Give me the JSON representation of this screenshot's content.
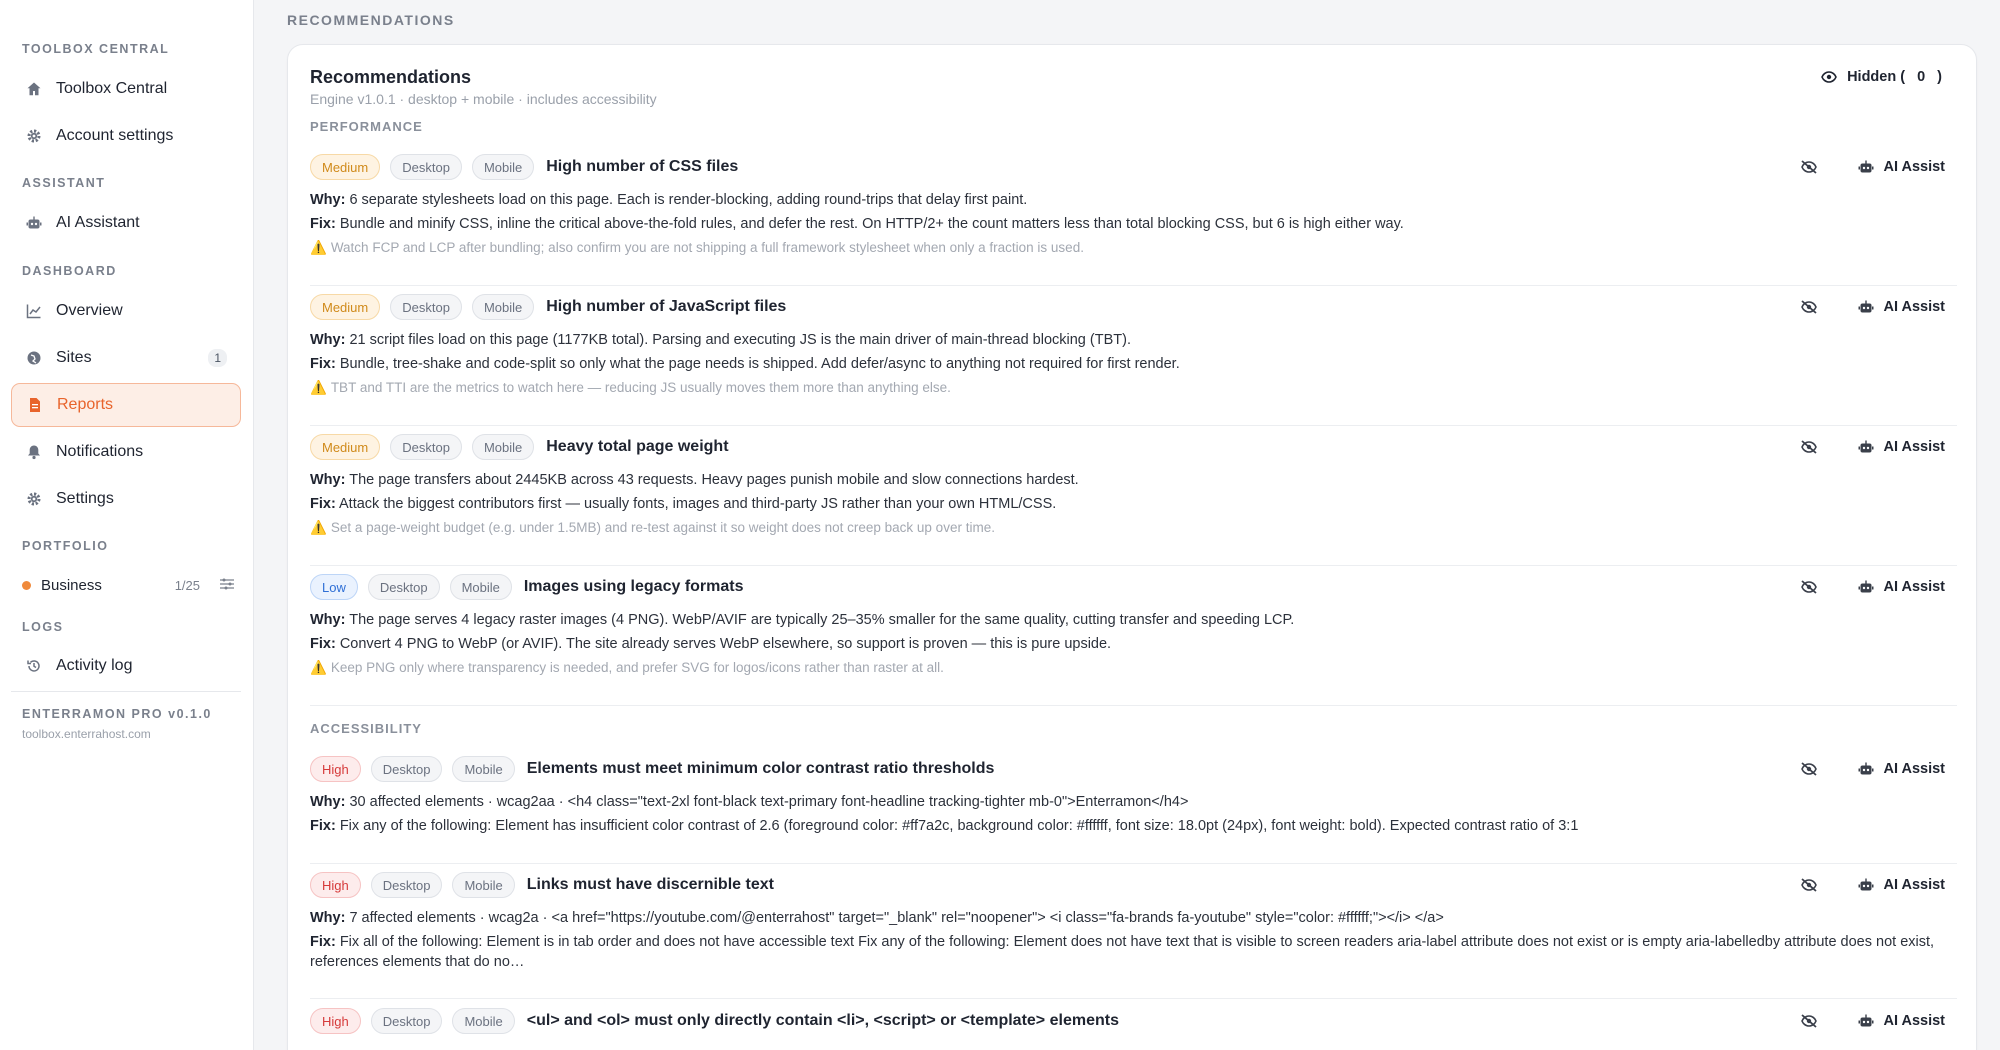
{
  "sidebar": {
    "sections": {
      "toolbox": "TOOLBOX CENTRAL",
      "assistant": "ASSISTANT",
      "dashboard": "DASHBOARD",
      "portfolio": "PORTFOLIO",
      "logs": "LOGS"
    },
    "items": {
      "toolbox_central": "Toolbox Central",
      "account_settings": "Account settings",
      "ai_assistant": "AI Assistant",
      "overview": "Overview",
      "sites": "Sites",
      "sites_badge": "1",
      "reports": "Reports",
      "notifications": "Notifications",
      "settings": "Settings",
      "activity_log": "Activity log"
    },
    "portfolio": {
      "name": "Business",
      "count": "1/25",
      "dot_color": "#f08a3c"
    },
    "version": "ENTERRAMON PRO v0.1.0",
    "host": "toolbox.enterrahost.com",
    "accent": "#e8642c"
  },
  "main": {
    "page_header": "RECOMMENDATIONS",
    "card": {
      "title": "Recommendations",
      "subtitle": "Engine v1.0.1 · desktop + mobile · includes accessibility",
      "hidden_label": "Hidden (",
      "hidden_count": "0",
      "hidden_close": ")"
    },
    "groups": {
      "performance": "PERFORMANCE",
      "accessibility": "ACCESSIBILITY"
    },
    "labels": {
      "why": "Why:",
      "fix": "Fix:",
      "desktop": "Desktop",
      "mobile": "Mobile",
      "ai_assist": "AI Assist",
      "warn_icon": "⚠️"
    },
    "recs": [
      {
        "severity": "Medium",
        "title": "High number of CSS files",
        "why": "6 separate stylesheets load on this page. Each is render-blocking, adding round-trips that delay first paint.",
        "fix": "Bundle and minify CSS, inline the critical above-the-fold rules, and defer the rest. On HTTP/2+ the count matters less than total blocking CSS, but 6 is high either way.",
        "note": "Watch FCP and LCP after bundling; also confirm you are not shipping a full framework stylesheet when only a fraction is used."
      },
      {
        "severity": "Medium",
        "title": "High number of JavaScript files",
        "why": "21 script files load on this page (1177KB total). Parsing and executing JS is the main driver of main-thread blocking (TBT).",
        "fix": "Bundle, tree-shake and code-split so only what the page needs is shipped. Add defer/async to anything not required for first render.",
        "note": "TBT and TTI are the metrics to watch here — reducing JS usually moves them more than anything else."
      },
      {
        "severity": "Medium",
        "title": "Heavy total page weight",
        "why": "The page transfers about 2445KB across 43 requests. Heavy pages punish mobile and slow connections hardest.",
        "fix": "Attack the biggest contributors first — usually fonts, images and third-party JS rather than your own HTML/CSS.",
        "note": "Set a page-weight budget (e.g. under 1.5MB) and re-test against it so weight does not creep back up over time."
      },
      {
        "severity": "Low",
        "title": "Images using legacy formats",
        "why": "The page serves 4 legacy raster images (4 PNG). WebP/AVIF are typically 25–35% smaller for the same quality, cutting transfer and speeding LCP.",
        "fix": "Convert 4 PNG to WebP (or AVIF). The site already serves WebP elsewhere, so support is proven — this is pure upside.",
        "note": "Keep PNG only where transparency is needed, and prefer SVG for logos/icons rather than raster at all."
      },
      {
        "severity": "High",
        "title": "Elements must meet minimum color contrast ratio thresholds",
        "why": "30 affected elements · wcag2aa · <h4 class=\"text-2xl font-black text-primary font-headline tracking-tighter mb-0\">Enterramon</h4>",
        "fix": "Fix any of the following: Element has insufficient color contrast of 2.6 (foreground color: #ff7a2c, background color: #ffffff, font size: 18.0pt (24px), font weight: bold). Expected contrast ratio of 3:1"
      },
      {
        "severity": "High",
        "title": "Links must have discernible text",
        "why": "7 affected elements · wcag2a · <a href=\"https://youtube.com/@enterrahost\" target=\"_blank\" rel=\"noopener\"> <i class=\"fa-brands fa-youtube\" style=\"color: #ffffff;\"></i> </a>",
        "fix": "Fix all of the following: Element is in tab order and does not have accessible text Fix any of the following: Element does not have text that is visible to screen readers aria-label attribute does not exist or is empty aria-labelledby attribute does not exist, references elements that do no…"
      },
      {
        "severity": "High",
        "title": "<ul> and <ol> must only directly contain <li>, <script> or <template> elements"
      }
    ]
  }
}
